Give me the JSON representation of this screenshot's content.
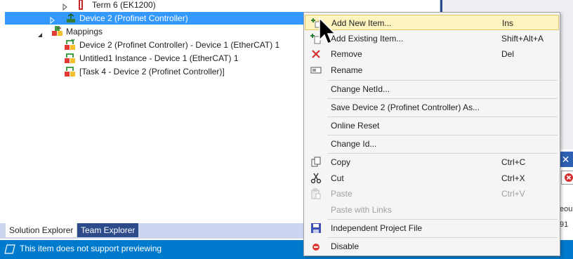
{
  "tree": {
    "items": [
      {
        "label": "Term 6 (EK1200)"
      },
      {
        "label": "Device 2 (Profinet Controller)"
      },
      {
        "label": "Mappings"
      },
      {
        "label": "Device 2 (Profinet Controller) - Device 1 (EtherCAT) 1"
      },
      {
        "label": "Untitled1 Instance - Device 1 (EtherCAT) 1"
      },
      {
        "label": "[Task 4 - Device 2 (Profinet Controller)]"
      }
    ]
  },
  "tabs": {
    "solution": "Solution Explorer",
    "team": "Team Explorer"
  },
  "status": {
    "text": "This item does not support previewing"
  },
  "right_panel": {
    "text1": "eou",
    "text2": "91"
  },
  "context_menu": {
    "items": [
      {
        "label": "Add New Item...",
        "key": "Ins"
      },
      {
        "label": "Add Existing Item...",
        "key": "Shift+Alt+A"
      },
      {
        "label": "Remove",
        "key": "Del"
      },
      {
        "label": "Rename",
        "key": ""
      },
      {
        "label": "Change NetId...",
        "key": ""
      },
      {
        "label": "Save Device 2 (Profinet Controller) As...",
        "key": ""
      },
      {
        "label": "Online Reset",
        "key": ""
      },
      {
        "label": "Change Id...",
        "key": ""
      },
      {
        "label": "Copy",
        "key": "Ctrl+C"
      },
      {
        "label": "Cut",
        "key": "Ctrl+X"
      },
      {
        "label": "Paste",
        "key": "Ctrl+V"
      },
      {
        "label": "Paste with Links",
        "key": ""
      },
      {
        "label": "Independent Project File",
        "key": ""
      },
      {
        "label": "Disable",
        "key": ""
      }
    ]
  },
  "icons": {
    "expand": "expand-arrow-icon",
    "collapse": "collapse-arrow-icon",
    "terminal": "terminal-icon",
    "device": "profinet-device-icon",
    "mappings": "mappings-icon",
    "mapping": "mapping-icon",
    "add_new": "add-new-item-icon",
    "add_existing": "add-existing-item-icon",
    "remove": "remove-icon",
    "rename": "rename-icon",
    "copy": "copy-icon",
    "cut": "cut-icon",
    "paste": "paste-icon",
    "save": "save-icon",
    "disable": "disable-icon",
    "preview": "preview-icon"
  },
  "colors": {
    "selection": "#3399ff",
    "status_bar": "#007acc",
    "menu_highlight": "#fdf4bf",
    "remove_red": "#d32f2f"
  }
}
